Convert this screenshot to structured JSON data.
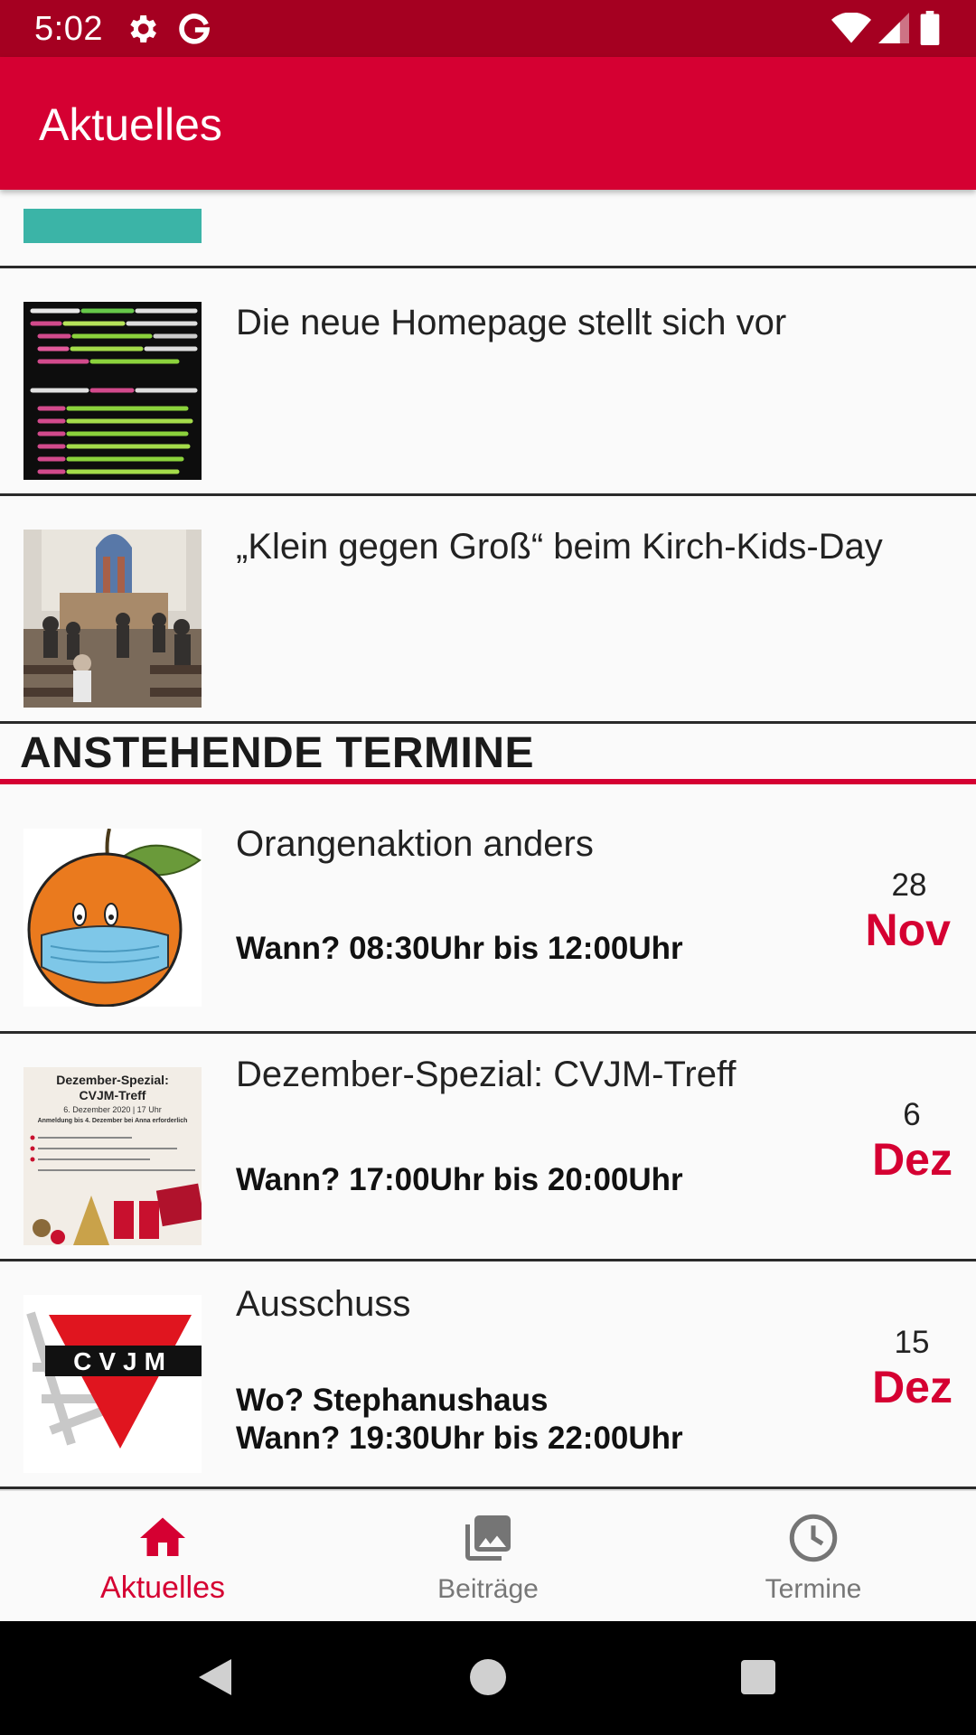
{
  "status_bar": {
    "time": "5:02"
  },
  "app_bar": {
    "title": "Aktuelles"
  },
  "posts": [
    {
      "title": "Die neue Homepage stellt sich vor"
    },
    {
      "title": "„Klein gegen Groß“ beim Kirch-Kids-Day"
    }
  ],
  "section": {
    "title": "ANSTEHENDE TERMINE"
  },
  "events": [
    {
      "title": "Orangenaktion anders",
      "where": "",
      "when": "Wann? 08:30Uhr bis 12:00Uhr",
      "day": "28",
      "month": "Nov"
    },
    {
      "title": "Dezember-Spezial: CVJM-Treff",
      "where": "",
      "when": "Wann? 17:00Uhr bis 20:00Uhr",
      "day": "6",
      "month": "Dez",
      "flyer": {
        "line1": "Dezember-Spezial:",
        "line2": "CVJM-Treff",
        "line3": "6. Dezember 2020 | 17 Uhr",
        "line4": "Anmeldung bis 4. Dezember bei Anna erforderlich"
      }
    },
    {
      "title": "Ausschuss",
      "where": "Wo? Stephanushaus",
      "when": "Wann? 19:30Uhr bis 22:00Uhr",
      "day": "15",
      "month": "Dez",
      "logo_text": "CVJM"
    }
  ],
  "bottom_nav": [
    {
      "label": "Aktuelles",
      "icon": "home-icon",
      "active": true
    },
    {
      "label": "Beiträge",
      "icon": "photo-library-icon",
      "active": false
    },
    {
      "label": "Termine",
      "icon": "clock-icon",
      "active": false
    }
  ],
  "colors": {
    "primary": "#d50032",
    "status_bar": "#a50021",
    "teal": "#3bb4a7"
  }
}
